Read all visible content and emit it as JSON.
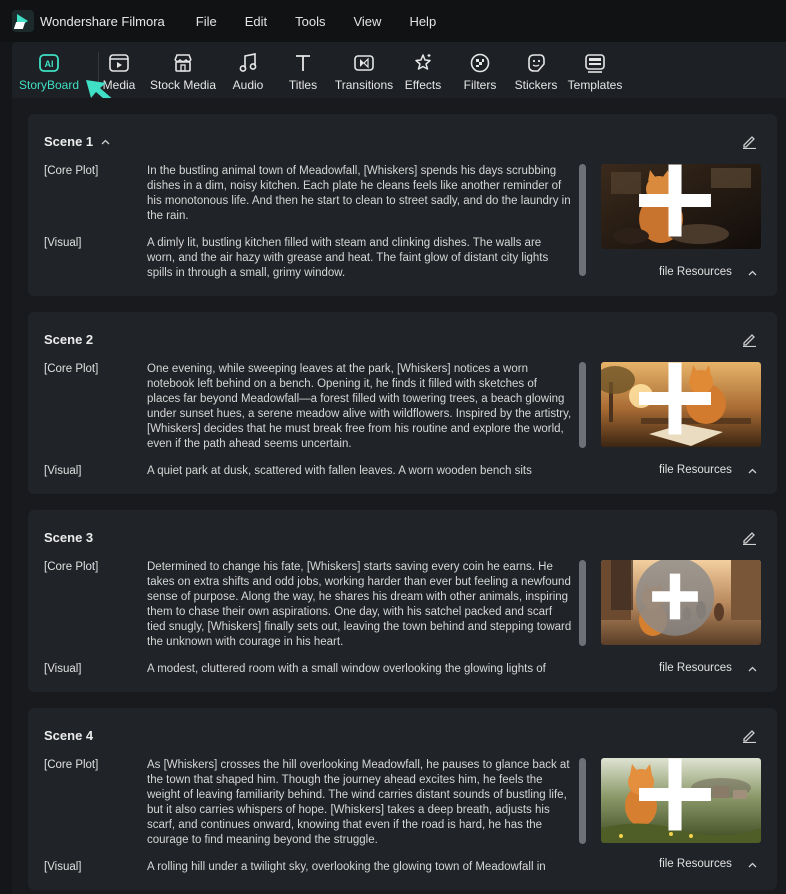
{
  "app": {
    "name": "Wondershare Filmora"
  },
  "menu": [
    "File",
    "Edit",
    "Tools",
    "View",
    "Help"
  ],
  "toolbar": {
    "items": [
      {
        "label": "StoryBoard",
        "icon": "ai-storyboard-icon",
        "active": true
      },
      {
        "label": "Media",
        "icon": "media-icon"
      },
      {
        "label": "Stock Media",
        "icon": "stock-media-icon"
      },
      {
        "label": "Audio",
        "icon": "audio-note-icon"
      },
      {
        "label": "Titles",
        "icon": "titles-t-icon"
      },
      {
        "label": "Transitions",
        "icon": "transitions-icon"
      },
      {
        "label": "Effects",
        "icon": "effects-icon"
      },
      {
        "label": "Filters",
        "icon": "filters-icon"
      },
      {
        "label": "Stickers",
        "icon": "stickers-icon"
      },
      {
        "label": "Templates",
        "icon": "templates-icon"
      }
    ],
    "accent_color": "#3fe0c5"
  },
  "scenes": [
    {
      "title": "Scene 1",
      "expanded": true,
      "core_label": "[Core Plot]",
      "core_text": "In the bustling animal town of Meadowfall, [Whiskers] spends his days scrubbing dishes in a dim, noisy kitchen. Each plate he cleans feels like another reminder of his monotonous life. And then he start to clean to street sadly, and do the laundry in the rain.",
      "visual_label": "[Visual]",
      "visual_text": "A dimly lit, bustling kitchen filled with steam and clinking dishes. The walls are worn, and the air hazy with grease and heat. The faint glow of distant city lights spills in through a small, grimy window.",
      "resources_label": "file Resources"
    },
    {
      "title": "Scene 2",
      "core_label": "[Core Plot]",
      "core_text": "One evening, while sweeping leaves at the park, [Whiskers] notices a worn notebook left behind on a bench. Opening it, he finds it filled with sketches of places far beyond Meadowfall—a forest filled with towering trees, a beach glowing under sunset hues, a serene meadow alive with wildflowers. Inspired by the artistry, [Whiskers] decides that he must break free from his routine and explore the world, even if the path ahead seems uncertain.",
      "visual_label": "[Visual]",
      "visual_text": "A quiet park at dusk, scattered with fallen leaves. A worn wooden bench sits",
      "resources_label": "file Resources"
    },
    {
      "title": "Scene 3",
      "core_label": "[Core Plot]",
      "core_text": "Determined to change his fate, [Whiskers] starts saving every coin he earns. He takes on extra shifts and odd jobs, working harder than ever but feeling a newfound sense of purpose. Along the way, he shares his dream with other animals, inspiring them to chase their own aspirations. One day, with his satchel packed and scarf tied snugly, [Whiskers] finally sets out, leaving the town behind and stepping toward the unknown with courage in his heart.",
      "visual_label": "[Visual]",
      "visual_text": "A modest, cluttered room with a small window overlooking the glowing lights of",
      "resources_label": "file Resources"
    },
    {
      "title": "Scene 4",
      "core_label": "[Core Plot]",
      "core_text": "As [Whiskers] crosses the hill overlooking Meadowfall, he pauses to glance back at the town that shaped him. Though the journey ahead excites him, he feels the weight of leaving familiarity behind. The wind carries distant sounds of bustling life, but it also carries whispers of hope. [Whiskers] takes a deep breath, adjusts his scarf, and continues onward, knowing that even if the road is hard, he has the courage to find meaning beyond the struggle.",
      "visual_label": "[Visual]",
      "visual_text": "A rolling hill under a twilight sky, overlooking the glowing town of Meadowfall in",
      "resources_label": "file Resources"
    }
  ]
}
